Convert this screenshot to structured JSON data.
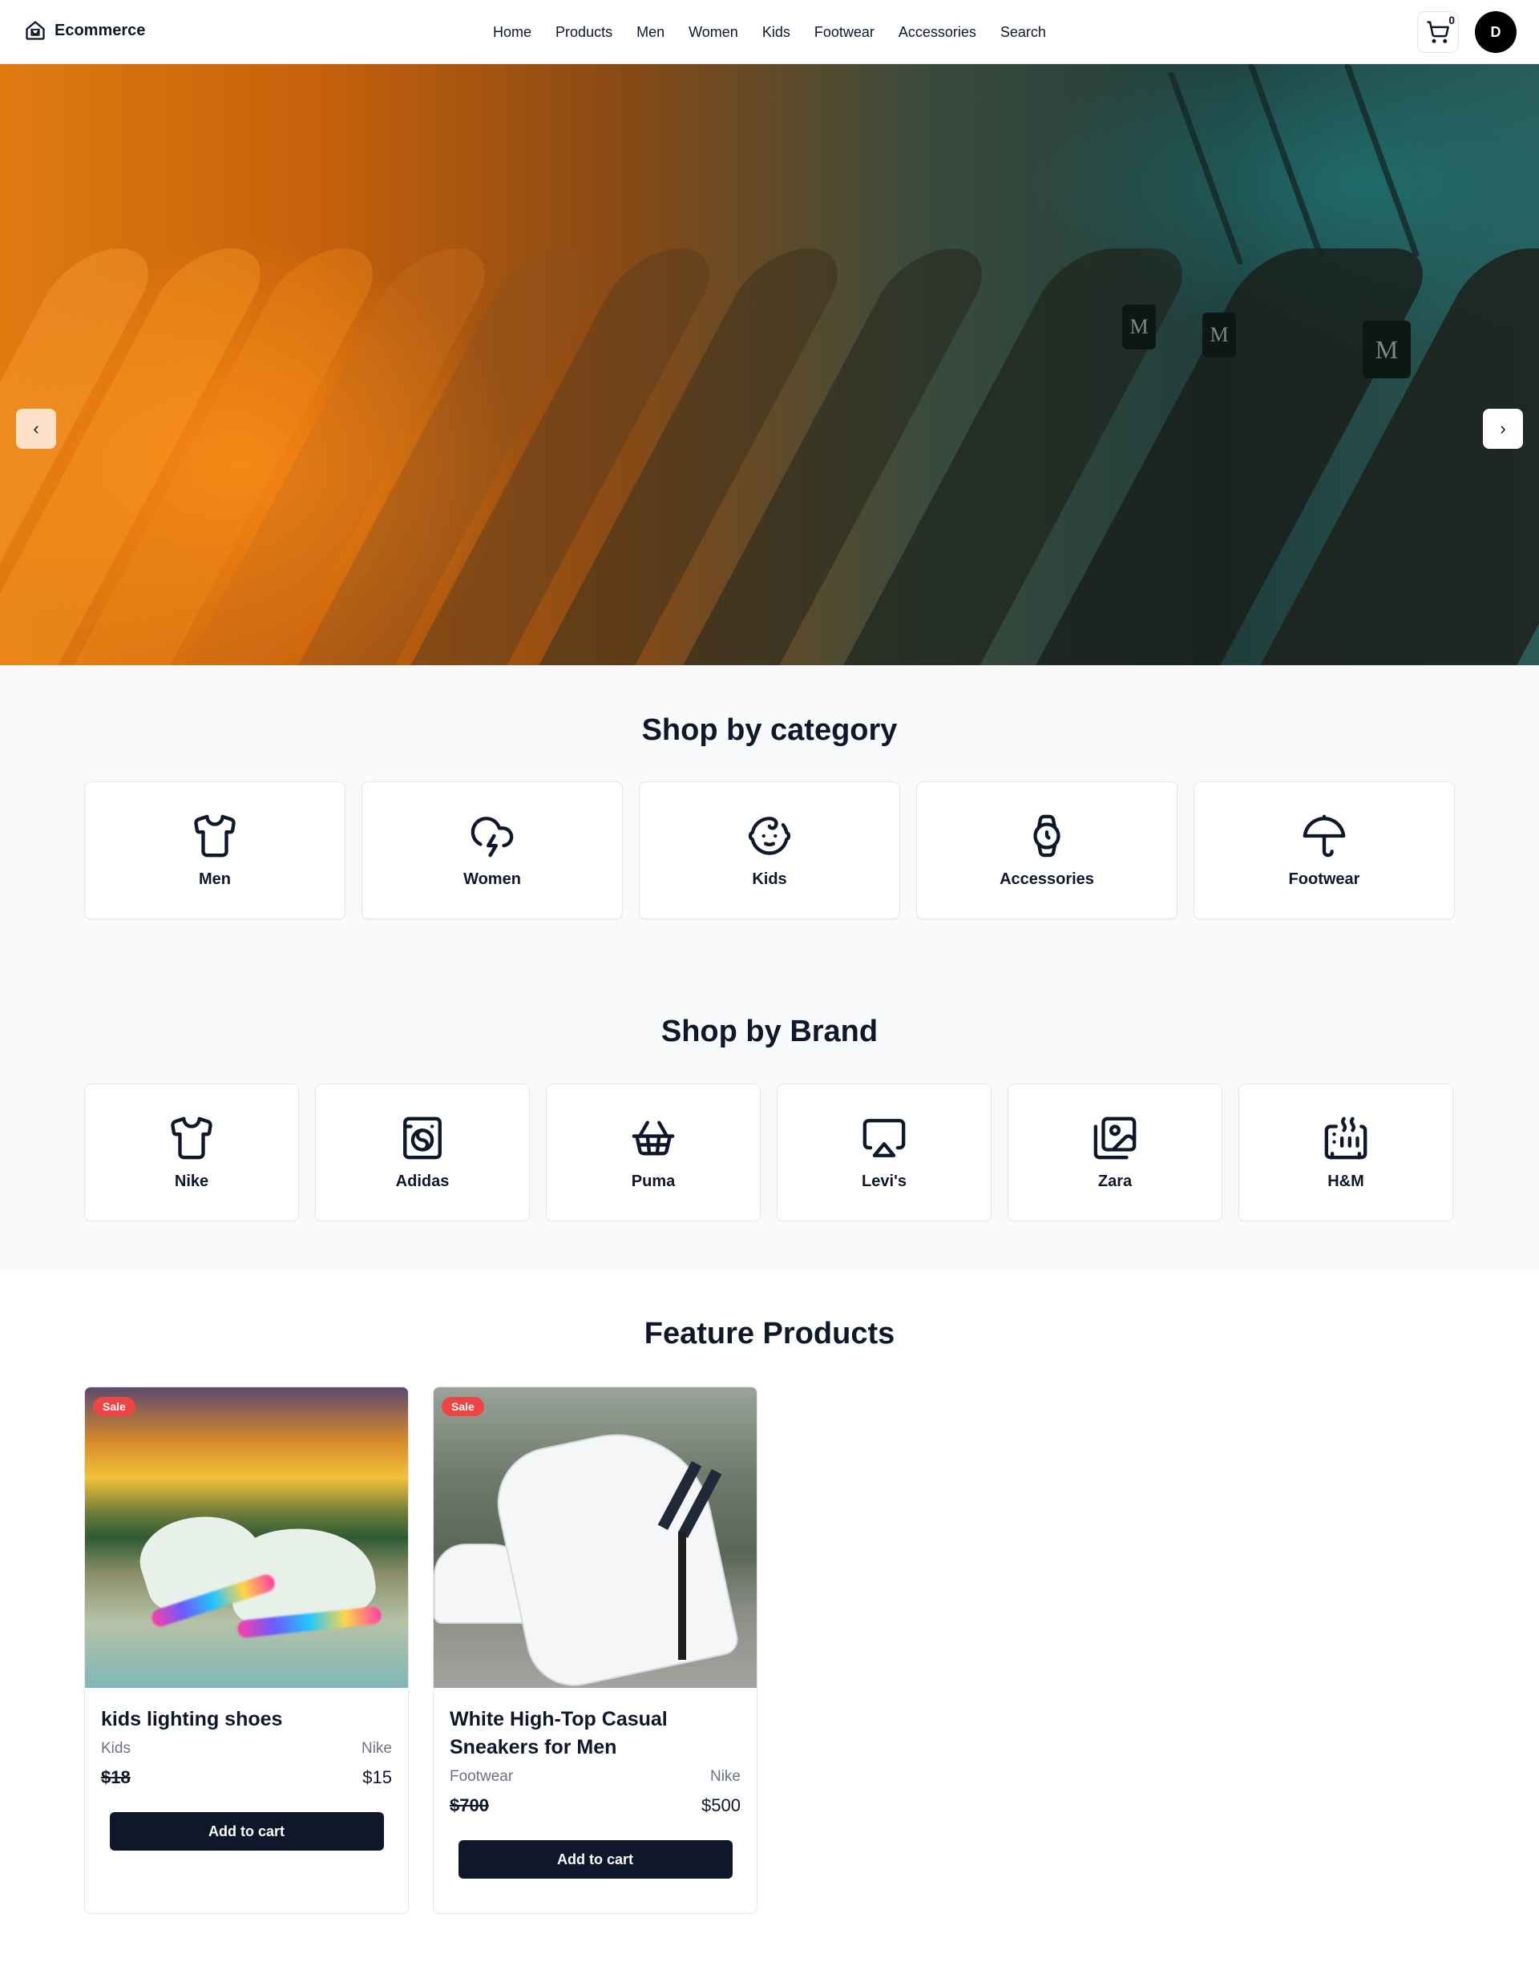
{
  "header": {
    "brand": "Ecommerce",
    "nav": [
      "Home",
      "Products",
      "Men",
      "Women",
      "Kids",
      "Footwear",
      "Accessories",
      "Search"
    ],
    "cart_count": "0",
    "avatar_initial": "D"
  },
  "hero": {
    "tag_letter": "M",
    "prev_symbol": "‹",
    "next_symbol": "›"
  },
  "categories": {
    "title": "Shop by category",
    "items": [
      {
        "label": "Men",
        "icon": "shirt-icon"
      },
      {
        "label": "Women",
        "icon": "cloud-lightning-icon"
      },
      {
        "label": "Kids",
        "icon": "baby-icon"
      },
      {
        "label": "Accessories",
        "icon": "watch-icon"
      },
      {
        "label": "Footwear",
        "icon": "umbrella-icon"
      }
    ]
  },
  "brands": {
    "title": "Shop by Brand",
    "items": [
      {
        "label": "Nike",
        "icon": "shirt-icon"
      },
      {
        "label": "Adidas",
        "icon": "washing-machine-icon"
      },
      {
        "label": "Puma",
        "icon": "shopping-basket-icon"
      },
      {
        "label": "Levi's",
        "icon": "airplay-icon"
      },
      {
        "label": "Zara",
        "icon": "images-icon"
      },
      {
        "label": "H&M",
        "icon": "heater-icon"
      }
    ]
  },
  "featured": {
    "title": "Feature Products",
    "products": [
      {
        "badge": "Sale",
        "title": "kids lighting shoes",
        "category": "Kids",
        "brand": "Nike",
        "old_price": "$18",
        "price": "$15",
        "button": "Add to cart"
      },
      {
        "badge": "Sale",
        "title": "White High-Top Casual Sneakers for Men",
        "category": "Footwear",
        "brand": "Nike",
        "old_price": "$700",
        "price": "$500",
        "button": "Add to cart"
      }
    ]
  },
  "colors": {
    "text": "#0f172a",
    "muted": "#6b7280",
    "sale": "#ef4444",
    "section_bg": "#f8fafc",
    "button": "#0f172a"
  }
}
